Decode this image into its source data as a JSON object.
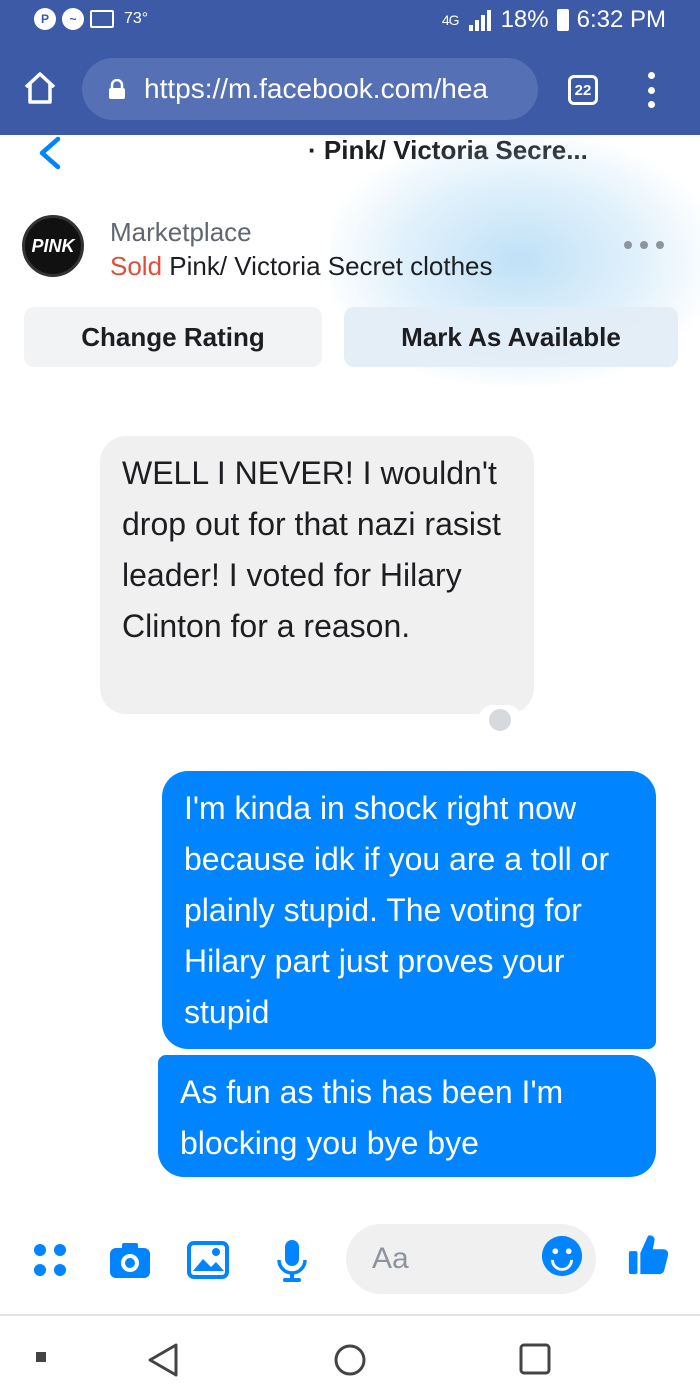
{
  "status_bar": {
    "temperature": "73°",
    "battery": "18%",
    "time": "6:32 PM",
    "network": "4G"
  },
  "browser": {
    "url": "https://m.facebook.com/hea",
    "tab_count": "22"
  },
  "conversation": {
    "title": "· Pink/ Victoria Secre..."
  },
  "marketplace": {
    "label": "Marketplace",
    "status": "Sold",
    "item": " Pink/ Victoria Secret clothes",
    "avatar_text": "PINK",
    "change_rating_label": "Change Rating",
    "mark_available_label": "Mark As Available"
  },
  "messages": [
    {
      "direction": "incoming",
      "text": "WELL I NEVER! I wouldn't drop out for that nazi rasist leader! I voted for Hilary Clinton for a reason."
    },
    {
      "direction": "outgoing",
      "text": "I'm kinda in shock right now because idk if you are a toll or plainly stupid. The voting for Hilary part just proves your stupid"
    },
    {
      "direction": "outgoing",
      "text": "As fun as this has been I'm blocking you bye bye"
    }
  ],
  "composer": {
    "placeholder": "Aa"
  },
  "colors": {
    "chrome_blue": "#3c5aa6",
    "messenger_blue": "#0084ff",
    "sold_red": "#e04e39",
    "incoming_bubble": "#f1f0f0"
  },
  "icons": [
    "home-icon",
    "lock-icon",
    "tabs-icon",
    "overflow-menu-icon",
    "back-icon",
    "more-options-icon",
    "apps-icon",
    "camera-icon",
    "image-icon",
    "microphone-icon",
    "emoji-icon",
    "like-icon",
    "nav-back-icon",
    "nav-home-icon",
    "nav-recents-icon"
  ]
}
